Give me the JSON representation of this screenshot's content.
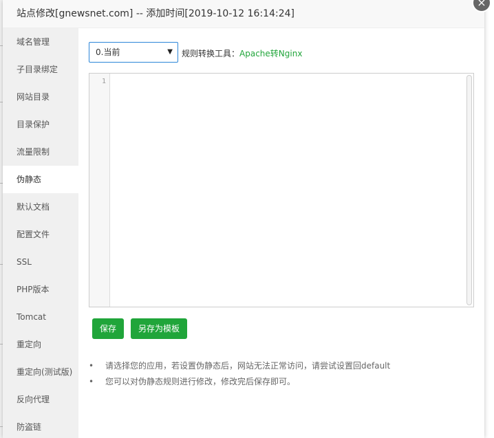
{
  "dialog": {
    "title": "站点修改[gnewsnet.com] -- 添加时间[2019-10-12 16:14:24]",
    "close_glyph": "×"
  },
  "sidebar": {
    "items": [
      {
        "label": "域名管理"
      },
      {
        "label": "子目录绑定"
      },
      {
        "label": "网站目录"
      },
      {
        "label": "目录保护"
      },
      {
        "label": "流量限制"
      },
      {
        "label": "伪静态",
        "active": true
      },
      {
        "label": "默认文档"
      },
      {
        "label": "配置文件"
      },
      {
        "label": "SSL"
      },
      {
        "label": "PHP版本"
      },
      {
        "label": "Tomcat"
      },
      {
        "label": "重定向"
      },
      {
        "label": "重定向(测试版)"
      },
      {
        "label": "反向代理"
      },
      {
        "label": "防盗链"
      }
    ]
  },
  "main": {
    "select_value": "0.当前",
    "select_caret": "▼",
    "tool_label": "规则转换工具：",
    "tool_link": "Apache转Nginx",
    "editor": {
      "line_numbers": [
        "1"
      ],
      "content": ""
    },
    "buttons": {
      "save": "保存",
      "save_as_template": "另存为模板"
    },
    "tips": [
      "请选择您的应用，若设置伪静态后，网站无法正常访问，请尝试设置回default",
      "您可以对伪静态规则进行修改，修改完后保存即可。"
    ],
    "tip_bullet": "•"
  },
  "colors": {
    "accent_green": "#20a53a",
    "select_border": "#2a85d8",
    "sidebar_bg": "#f0f0f0"
  },
  "icons": {
    "close": "close-icon",
    "dropdown": "chevron-down-icon"
  }
}
